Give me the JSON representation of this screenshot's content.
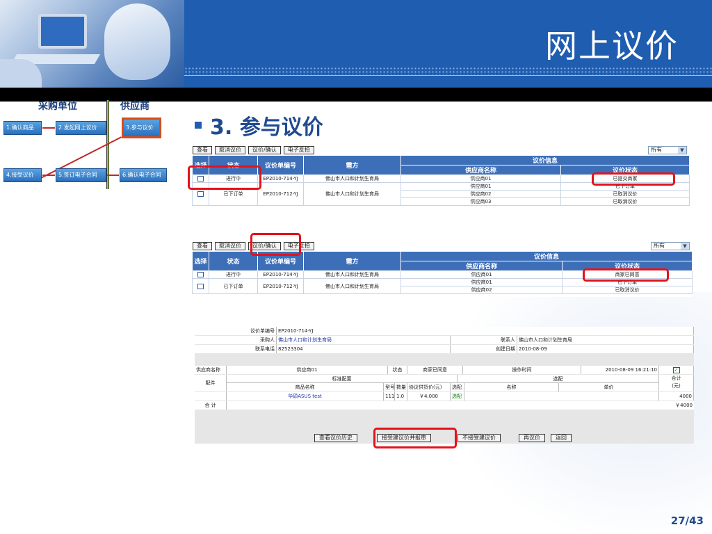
{
  "slide": {
    "title": "网上议价",
    "page": "27/43"
  },
  "bullet": "3. 参与议价",
  "flow": {
    "col1": "采购单位",
    "col2": "供应商",
    "steps": [
      "1.确认商品",
      "2.发起网上议价",
      "3.参与议价",
      "4.接受议价",
      "5.签订电子合同",
      "6.确认电子合同"
    ]
  },
  "toolbar": {
    "buttons": [
      "查看",
      "取消议价",
      "议价/确认",
      "电子反拍"
    ],
    "select": "所有"
  },
  "table_headers": {
    "select": "选择",
    "status": "状态",
    "code": "议价单编号",
    "buyer": "需方",
    "info": "议价信息",
    "supplier": "供应商名称",
    "bstatus": "议价状态"
  },
  "table1": {
    "rows": [
      {
        "status": "进行中",
        "code": "EP2010-714-YJ",
        "buyer": "佛山市人口和计划生育局",
        "suppliers": [
          {
            "name": "供应商01",
            "state": "已提交商家"
          }
        ]
      },
      {
        "status": "已下订单",
        "code": "EP2010-712-YJ",
        "buyer": "佛山市人口和计划生育局",
        "suppliers": [
          {
            "name": "供应商01",
            "state": "已下订单"
          },
          {
            "name": "供应商02",
            "state": "已取消议价"
          },
          {
            "name": "供应商03",
            "state": "已取消议价"
          }
        ]
      }
    ]
  },
  "table2": {
    "rows": [
      {
        "status": "进行中",
        "code": "EP2010-714-YJ",
        "buyer": "佛山市人口和计划生育局",
        "suppliers": [
          {
            "name": "供应商01",
            "state": "商家已同意"
          }
        ]
      },
      {
        "status": "已下订单",
        "code": "EP2010-712-YJ",
        "buyer": "佛山市人口和计划生育局",
        "suppliers": [
          {
            "name": "供应商01",
            "state": "已下订单"
          },
          {
            "name": "供应商02",
            "state": "已取消议价"
          }
        ]
      }
    ]
  },
  "detail": {
    "code_label": "议价单编号",
    "code": "EP2010-714-YJ",
    "buyer_label": "采购人",
    "buyer": "佛山市人口和计划生育局",
    "contact_label": "联系人",
    "contact": "佛山市人口和计划生育局",
    "phone_label": "联系电话",
    "phone": "82523304",
    "date_label": "创建日期",
    "date": "2010-08-09",
    "sup_label": "供应商名称",
    "sup": "供应商01",
    "state_label": "状态",
    "state": "商家已同意",
    "optime_label": "操作时间",
    "optime": "2010-08-09 16:21:10",
    "parts_label": "配件",
    "std_label": "标准配置",
    "opt_label": "选配",
    "total_col_label": "合计\n(元)",
    "col_name": "商品名称",
    "col_model": "型号",
    "col_qty": "数量",
    "col_price": "协议供货价(元)",
    "col_opt": "选配",
    "col_opt_name": "名称",
    "col_unit": "单价",
    "item_name": "华硕ASUS test",
    "item_model": "111",
    "item_qty": "1.0",
    "item_price": "￥4,000",
    "item_opt": "选配",
    "item_total": "4000",
    "sum_label": "合 计",
    "sum": "￥4000",
    "buttons": [
      "查看议价历史",
      "接受建议价并报审",
      "不接受建议价",
      "再议价",
      "返回"
    ]
  }
}
